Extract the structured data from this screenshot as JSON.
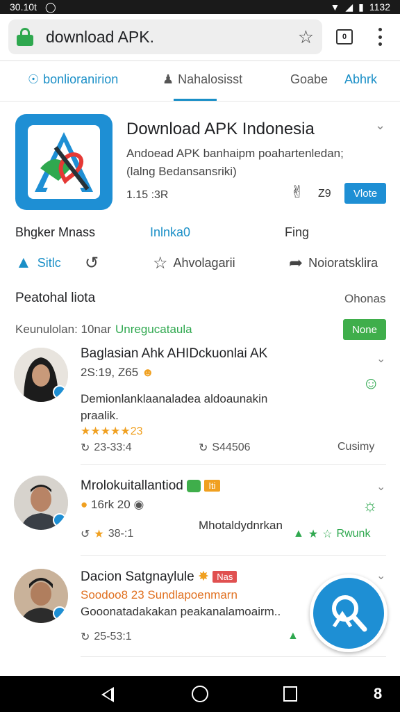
{
  "status": {
    "left_text": "30.10t",
    "time": "1132"
  },
  "browser": {
    "url": "download APK."
  },
  "nav": {
    "tabs": [
      {
        "label": "bonlioranirion"
      },
      {
        "label": "Nahalosisst"
      },
      {
        "label": "Goabe"
      },
      {
        "label": "Abhrk"
      }
    ]
  },
  "app": {
    "title": "Download APK Indonesia",
    "desc_line1": "Andoead APK banhaipm poahartenledan;",
    "desc_line2": "(lalng Bedansansriki)",
    "meta": "1.15 :3R",
    "like_count": "Z9",
    "vote_label": "Vlote"
  },
  "info": {
    "a": "Bhgker Mnass",
    "b": "Inlnka0",
    "c": "Fing"
  },
  "actions": {
    "a": "Sitlc",
    "b": "",
    "c": "Ahvolagarii",
    "d": "Noioratsklira"
  },
  "section": {
    "title": "Peatohal liota",
    "right": "Ohonas",
    "filter_label": "Keunulolan: 10nar",
    "filter_green": "Unregucataula",
    "new_btn": "None"
  },
  "reviews": [
    {
      "name": "Baglasian Ahk AHIDckuonlai AK",
      "sub": "2S:19, Z65",
      "text": "Demionlanklaanaladea aldoaunakin praalik.",
      "stars": "★★★★★23",
      "foot_left": "23-33:4",
      "foot_mid": "S44506",
      "foot_right": "Cusimy"
    },
    {
      "name": "Mrolokuitallantiod",
      "tag": "Iti",
      "sub": "16rk 20",
      "text": "Mhotaldydnrkan",
      "foot_left": "38-:1",
      "foot_right": "Rwunk"
    },
    {
      "name": "Dacion Satgnaylule",
      "tag": "Nas",
      "sub": "Soodoo8 23 Sundlapoenmarn",
      "text": "Gooonatadakakan peakanalamoairm..",
      "foot_left": "25-53:1"
    }
  ]
}
